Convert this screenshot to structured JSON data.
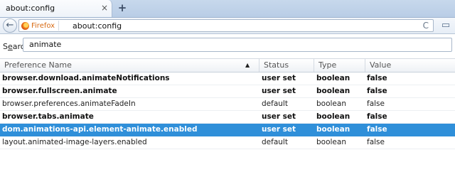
{
  "tab": {
    "title": "about:config",
    "close_glyph": "×",
    "new_tab_glyph": "+"
  },
  "navbar": {
    "back_glyph": "←",
    "identity_label": "Firefox",
    "url": "about:config",
    "reload_glyph": "C",
    "bookmarks_glyph": "▭"
  },
  "search": {
    "label_prefix": "S",
    "label_underlined": "e",
    "label_suffix": "arch:",
    "value": "animate"
  },
  "table": {
    "headers": {
      "name": "Preference Name",
      "status": "Status",
      "type": "Type",
      "value": "Value"
    },
    "sort_glyph": "▲",
    "rows": [
      {
        "name": "browser.download.animateNotifications",
        "status": "user set",
        "type": "boolean",
        "value": "false"
      },
      {
        "name": "browser.fullscreen.animate",
        "status": "user set",
        "type": "boolean",
        "value": "false"
      },
      {
        "name": "browser.preferences.animateFadeIn",
        "status": "default",
        "type": "boolean",
        "value": "false"
      },
      {
        "name": "browser.tabs.animate",
        "status": "user set",
        "type": "boolean",
        "value": "false"
      },
      {
        "name": "dom.animations-api.element-animate.enabled",
        "status": "user set",
        "type": "boolean",
        "value": "false"
      },
      {
        "name": "layout.animated-image-layers.enabled",
        "status": "default",
        "type": "boolean",
        "value": "false"
      }
    ]
  },
  "colors": {
    "selection": "#2f8fd9",
    "identity": "#d86a12"
  }
}
